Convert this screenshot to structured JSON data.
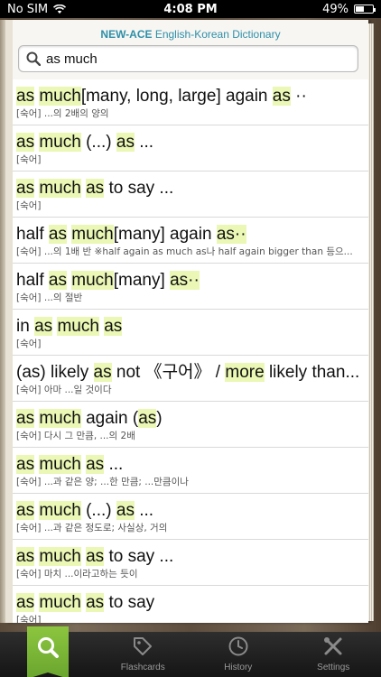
{
  "status_bar": {
    "carrier": "No SIM",
    "time": "4:08 PM",
    "battery_percent": "49%",
    "battery_level": 0.49
  },
  "header": {
    "title_bold": "NEW-ACE",
    "title_rest": " English-Korean Dictionary"
  },
  "search": {
    "value": "as much",
    "icon": "search-icon"
  },
  "results": [
    {
      "term": [
        [
          "as",
          "h"
        ],
        [
          " ",
          ""
        ],
        [
          "much",
          "h"
        ],
        [
          "[many, long, large] again ",
          ""
        ],
        [
          "as",
          "h"
        ],
        [
          " ··",
          ""
        ]
      ],
      "sub": "[숙어] ...의 2배의 양의"
    },
    {
      "term": [
        [
          "as",
          "h"
        ],
        [
          " ",
          ""
        ],
        [
          "much",
          "h"
        ],
        [
          " (...) ",
          ""
        ],
        [
          "as",
          "h"
        ],
        [
          " ...",
          ""
        ]
      ],
      "sub": "[숙어]"
    },
    {
      "term": [
        [
          "as",
          "h"
        ],
        [
          " ",
          ""
        ],
        [
          "much",
          "h"
        ],
        [
          " ",
          ""
        ],
        [
          "as",
          "h"
        ],
        [
          " to say ...",
          ""
        ]
      ],
      "sub": "[숙어]"
    },
    {
      "term": [
        [
          "half ",
          ""
        ],
        [
          "as",
          "h"
        ],
        [
          " ",
          ""
        ],
        [
          "much",
          "h"
        ],
        [
          "[many] again ",
          ""
        ],
        [
          "as··",
          "h"
        ]
      ],
      "sub": "[숙어] ...의 1배 반 ※half again as much as나 half again bigger than 등으..."
    },
    {
      "term": [
        [
          "half ",
          ""
        ],
        [
          "as",
          "h"
        ],
        [
          " ",
          ""
        ],
        [
          "much",
          "h"
        ],
        [
          "[many] ",
          ""
        ],
        [
          "as··",
          "h"
        ]
      ],
      "sub": "[숙어] ...의 절반"
    },
    {
      "term": [
        [
          "in ",
          ""
        ],
        [
          "as",
          "h"
        ],
        [
          " ",
          ""
        ],
        [
          "much",
          "h"
        ],
        [
          " ",
          ""
        ],
        [
          "as",
          "h"
        ]
      ],
      "sub": "[숙어]"
    },
    {
      "term": [
        [
          "(as) likely ",
          ""
        ],
        [
          "as",
          "h"
        ],
        [
          " not 《구어》 / ",
          ""
        ],
        [
          "more",
          "h"
        ],
        [
          " likely than...",
          ""
        ]
      ],
      "sub": "[숙어] 아마 ...일 것이다"
    },
    {
      "term": [
        [
          "as",
          "h"
        ],
        [
          " ",
          ""
        ],
        [
          "much",
          "h"
        ],
        [
          " again (",
          ""
        ],
        [
          "as",
          "h"
        ],
        [
          ")",
          ""
        ]
      ],
      "sub": "[숙어] 다시 그 만큼, ...의 2배"
    },
    {
      "term": [
        [
          "as",
          "h"
        ],
        [
          " ",
          ""
        ],
        [
          "much",
          "h"
        ],
        [
          " ",
          ""
        ],
        [
          "as",
          "h"
        ],
        [
          " ...",
          ""
        ]
      ],
      "sub": "[숙어] ...과 같은 양; ...한 만큼; ...만큼이나"
    },
    {
      "term": [
        [
          "as",
          "h"
        ],
        [
          " ",
          ""
        ],
        [
          "much",
          "h"
        ],
        [
          " (...) ",
          ""
        ],
        [
          "as",
          "h"
        ],
        [
          " ...",
          ""
        ]
      ],
      "sub": "[숙어] ...과 같은 정도로; 사실상, 거의"
    },
    {
      "term": [
        [
          "as",
          "h"
        ],
        [
          " ",
          ""
        ],
        [
          "much",
          "h"
        ],
        [
          " ",
          ""
        ],
        [
          "as",
          "h"
        ],
        [
          " to say ...",
          ""
        ]
      ],
      "sub": "[숙어] 마치 ...이라고하는 듯이"
    },
    {
      "term": [
        [
          "as",
          "h"
        ],
        [
          " ",
          ""
        ],
        [
          "much",
          "h"
        ],
        [
          " ",
          ""
        ],
        [
          "as",
          "h"
        ],
        [
          " to say",
          ""
        ]
      ],
      "sub": "[숙어]"
    }
  ],
  "tabs": [
    {
      "label": "",
      "icon": "search-icon",
      "active": true
    },
    {
      "label": "Flashcards",
      "icon": "tag-icon",
      "active": false
    },
    {
      "label": "History",
      "icon": "clock-icon",
      "active": false
    },
    {
      "label": "Settings",
      "icon": "tools-icon",
      "active": false
    }
  ],
  "colors": {
    "highlight": "#eaf7b5",
    "title": "#2f8fa8",
    "active_tab": "#8cc63f"
  }
}
